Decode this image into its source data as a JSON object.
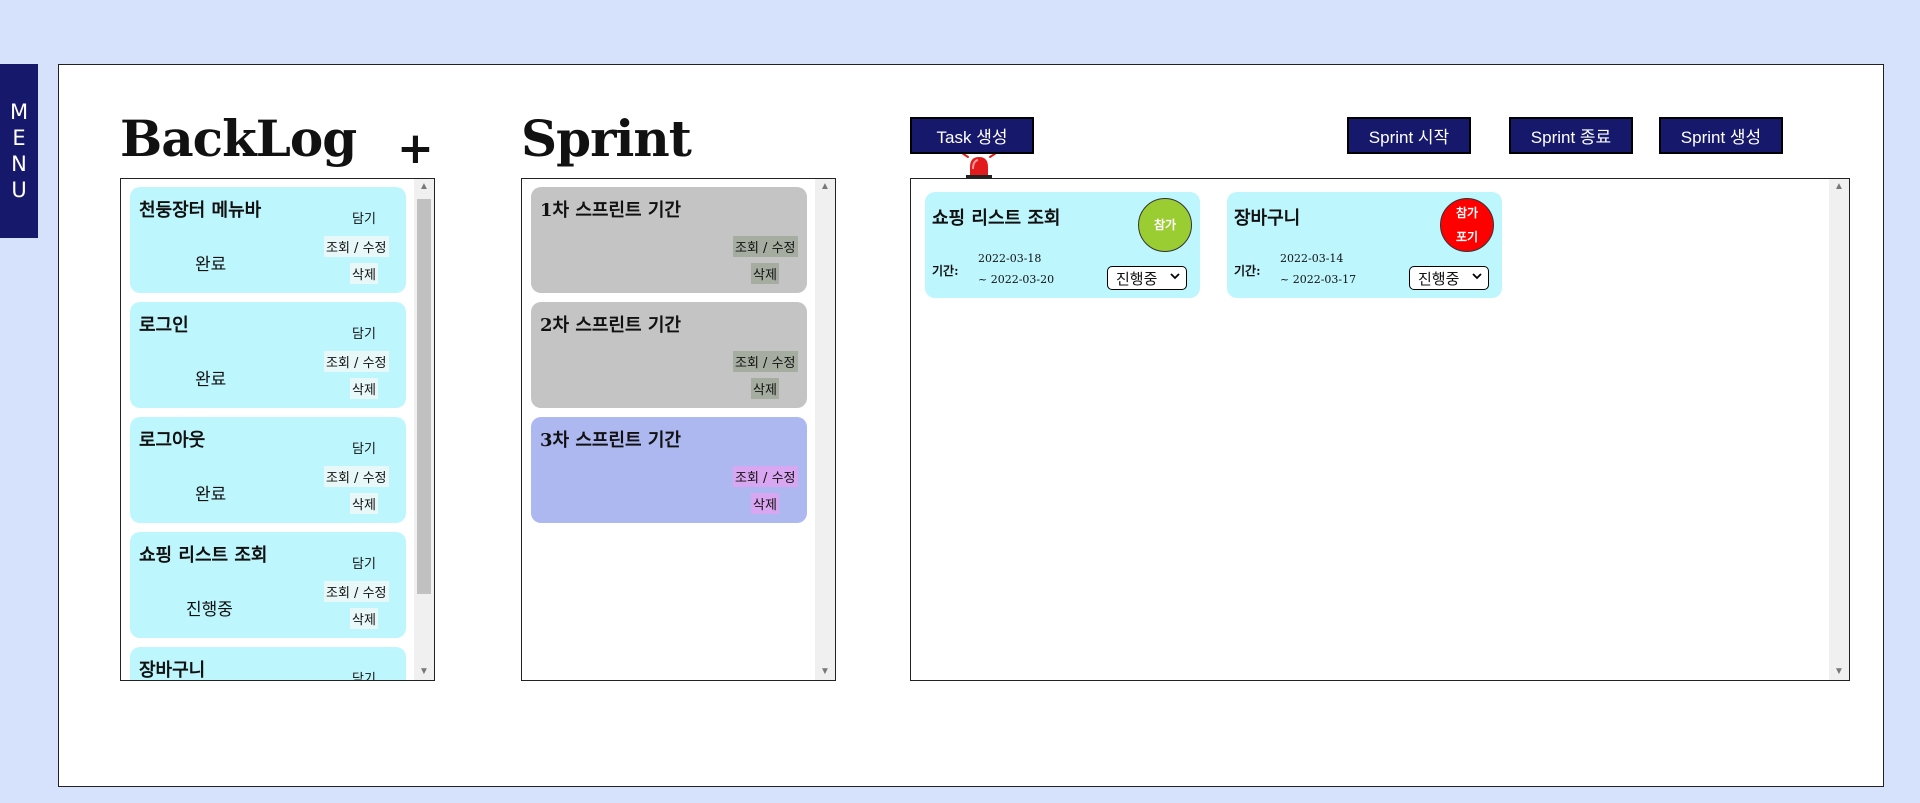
{
  "menu": {
    "letters": [
      "M",
      "E",
      "N",
      "U"
    ]
  },
  "backlog": {
    "title": "BackLog",
    "add_label": "+",
    "items": [
      {
        "title": "천둥장터 메뉴바",
        "add": "담기",
        "view_edit": "조회 / 수정",
        "delete": "삭제",
        "status": "완료"
      },
      {
        "title": "로그인",
        "add": "담기",
        "view_edit": "조회 / 수정",
        "delete": "삭제",
        "status": "완료"
      },
      {
        "title": "로그아웃",
        "add": "담기",
        "view_edit": "조회 / 수정",
        "delete": "삭제",
        "status": "완료"
      },
      {
        "title": "쇼핑 리스트 조회",
        "add": "담기",
        "view_edit": "조회 / 수정",
        "delete": "삭제",
        "status": "진행중"
      },
      {
        "title": "장바구니",
        "add": "담기"
      }
    ]
  },
  "sprint": {
    "title": "Sprint",
    "items": [
      {
        "title": "1차 스프린트 기간",
        "view_edit": "조회 / 수정",
        "delete": "삭제",
        "bg": "#c4c4c4",
        "hl": "#a5aca0"
      },
      {
        "title": "2차 스프린트 기간",
        "view_edit": "조회 / 수정",
        "delete": "삭제",
        "bg": "#c4c4c4",
        "hl": "#a5aca0"
      },
      {
        "title": "3차 스프린트 기간",
        "view_edit": "조회 / 수정",
        "delete": "삭제",
        "bg": "#acb8ef",
        "hl": "#d9a6f1"
      }
    ]
  },
  "toolbar": {
    "task_create": "Task 생성",
    "sprint_start": "Sprint 시작",
    "sprint_end": "Sprint 종료",
    "sprint_create": "Sprint 생성"
  },
  "tasks": [
    {
      "title": "쇼핑 리스트 조회",
      "circle_lines": [
        "참가"
      ],
      "circle_color": "#9acd32",
      "period_label": "기간:",
      "start": "2022-03-18",
      "end": "~ 2022-03-20",
      "status": "진행중"
    },
    {
      "title": "장바구니",
      "circle_lines": [
        "참가",
        "포기"
      ],
      "circle_color": "#ff0000",
      "period_label": "기간:",
      "start": "2022-03-14",
      "end": "~ 2022-03-17",
      "status": "진행중"
    }
  ],
  "colors": {
    "accent": "#16186b",
    "backlog_card": "#bef6fd",
    "task_card": "#bef6fd",
    "page_bg": "#d6e2fb"
  },
  "icons": {
    "siren": "siren-icon",
    "chevron": "chevron-down-icon"
  }
}
